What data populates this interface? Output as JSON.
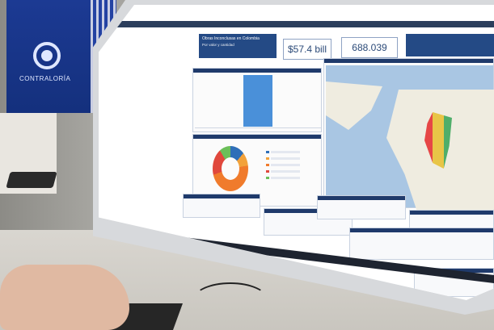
{
  "banner": {
    "logo_text": "CONTRALORÍA",
    "logo_icon": "contraloria-logo-icon"
  },
  "dashboard": {
    "title": "Obras Inconclusas en Colombia",
    "subtitle": "Por valor y cantidad",
    "kpi_1": "$57.4 bill",
    "kpi_2": "688.039"
  },
  "colors": {
    "header": "#1f3a6b",
    "bar": "#4a90d9",
    "donut_main": "#f07b2c"
  }
}
